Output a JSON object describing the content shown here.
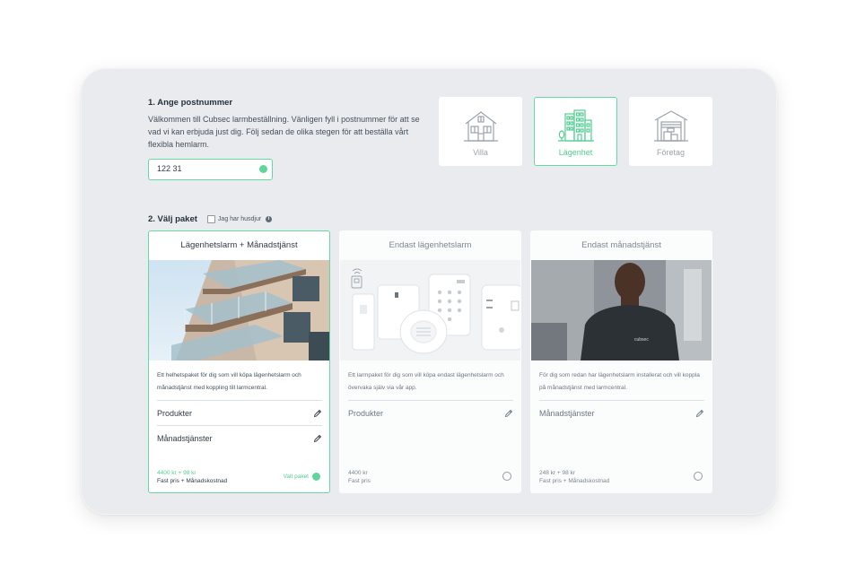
{
  "step1": {
    "title": "1. Ange postnummer",
    "description": "Välkommen till Cubsec larmbeställning. Vänligen fyll i postnummer för att se vad vi kan erbjuda just dig. Följ sedan de olika stegen för att beställa vårt flexibla hemlarm.",
    "postal_code_value": "122 31"
  },
  "housing_types": [
    {
      "label": "Villa",
      "icon": "house-icon",
      "selected": false
    },
    {
      "label": "Lägenhet",
      "icon": "apartment-building-icon",
      "selected": true
    },
    {
      "label": "Företag",
      "icon": "warehouse-icon",
      "selected": false
    }
  ],
  "step2": {
    "title": "2. Välj paket",
    "pet_checkbox_label": "Jag har husdjur",
    "info_icon": "i"
  },
  "packages": [
    {
      "title": "Lägenhetslarm + Månadstjänst",
      "image": "apartment-balconies-photo",
      "description": "Ett helhetspaket för dig som vill köpa lägenhetslarm och månadstjänst med koppling till larmcentral.",
      "rows": [
        "Produkter",
        "Månadstjänster"
      ],
      "price": "4400 kr + 98 kr",
      "price_note": "Fast pris + Månadskostnad",
      "selected_label": "Valt paket",
      "selected": true
    },
    {
      "title": "Endast lägenhetslarm",
      "image": "alarm-products-photo",
      "description": "Ett larmpaket för dig som vill köpa endast lägenhetslarm och övervaka själv via vår app.",
      "rows": [
        "Produkter"
      ],
      "price": "4400 kr",
      "price_note": "Fast pris",
      "selected": false
    },
    {
      "title": "Endast månadstjänst",
      "image": "cubsec-technician-photo",
      "description": "För dig som redan har lägenhetslarm installerat och vill koppla på månadstjänst med larmcentral.",
      "rows": [
        "Månadstjänster"
      ],
      "price": "248 kr + 98 kr",
      "price_note": "Fast pris + Månadskostnad",
      "selected": false
    }
  ],
  "shirt_logo_text": "cubsec",
  "colors": {
    "accent": "#63d9a1",
    "background": "#e9ebee",
    "text": "#2f3b47"
  }
}
